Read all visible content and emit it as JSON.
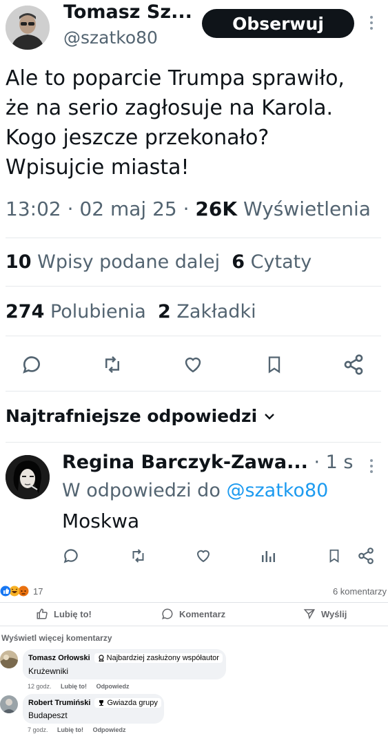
{
  "tweet": {
    "author_name": "Tomasz Sz...",
    "handle": "@szatko80",
    "follow_label": "Obserwuj",
    "text_lines": [
      "Ale to poparcie Trumpa sprawiło,",
      "że na serio zagłosuje na Karola.",
      "Kogo jeszcze przekonało?",
      "Wpisujcie miasta!"
    ],
    "time": "13:02",
    "sep": "·",
    "date": "02 maj 25",
    "views_count": "26K",
    "views_label": "Wyświetlenia",
    "reposts_count": "10",
    "reposts_label": "Wpisy podane dalej",
    "quotes_count": "6",
    "quotes_label": "Cytaty",
    "likes_count": "274",
    "likes_label": "Polubienia",
    "bookmarks_count": "2",
    "bookmarks_label": "Zakładki"
  },
  "replies_header": "Najtrafniejsze odpowiedzi",
  "reply": {
    "author_name": "Regina Barczyk-Zawa...",
    "time": "· 1 s",
    "in_reply_prefix": "W odpowiedzi do",
    "in_reply_handle": "@szatko80",
    "text": "Moskwa"
  },
  "fb": {
    "reactions_count": "17",
    "comments_count": "6 komentarzy",
    "like_label": "Lubię to!",
    "comment_label": "Komentarz",
    "share_label": "Wyślij",
    "more_comments": "Wyświetl więcej komentarzy",
    "comments": [
      {
        "author": "Tomasz Orłowski",
        "badge": "Najbardziej zasłużony współautor",
        "text": "Krużewniki",
        "time": "12 godz.",
        "like": "Lubię to!",
        "reply": "Odpowiedz"
      },
      {
        "author": "Robert Trumiński",
        "badge": "Gwiazda grupy",
        "text": "Budapeszt",
        "time": "7 godz.",
        "like": "Lubię to!",
        "reply": "Odpowiedz"
      }
    ]
  },
  "colors": {
    "link": "#1d9bf0",
    "fb_blue": "#1877f2",
    "text_gray": "#536471"
  }
}
